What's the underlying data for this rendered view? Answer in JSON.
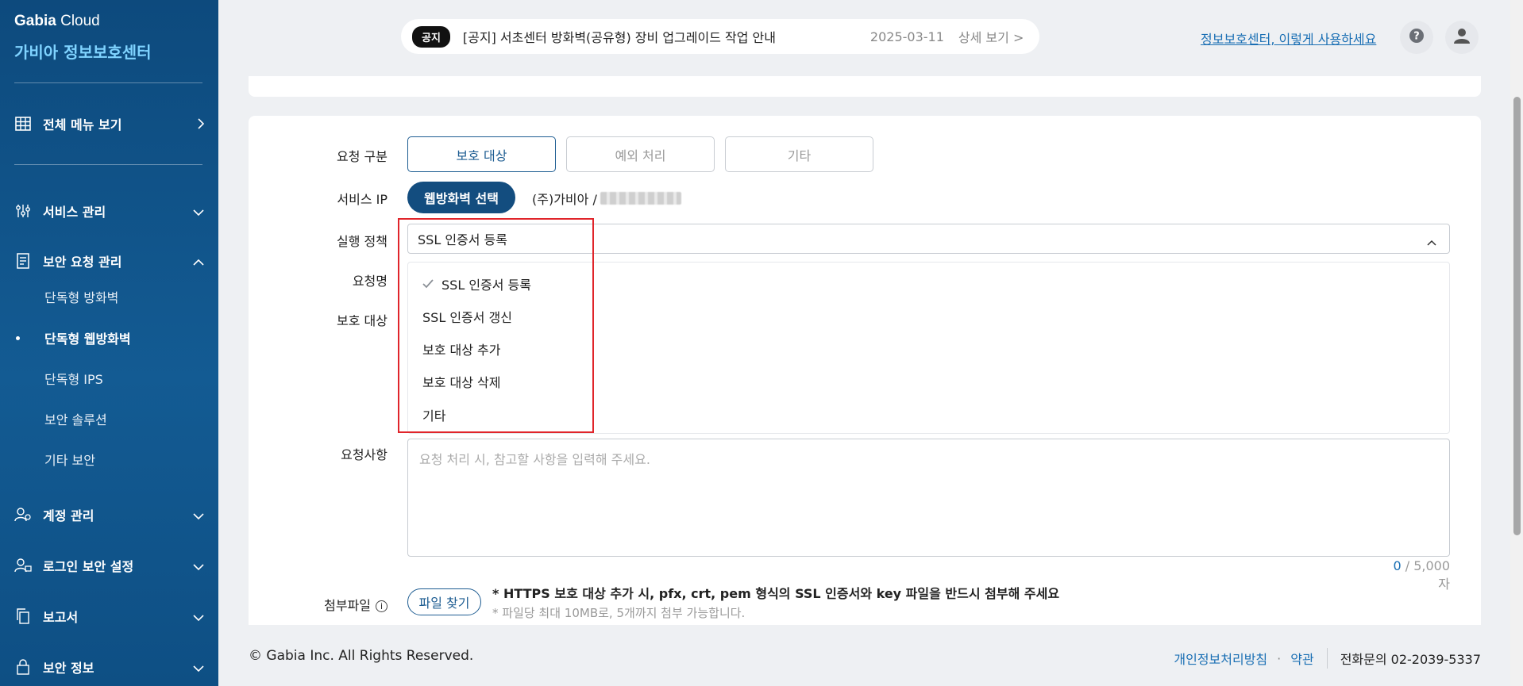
{
  "sidebar": {
    "brand_bold": "Gabia",
    "brand_rest": " Cloud",
    "brand_sub": "가비아 정보보호센터",
    "all_menu": "전체 메뉴 보기",
    "service_manage": "서비스 관리",
    "security_request": "보안 요청 관리",
    "sub_items": [
      "단독형 방화벽",
      "단독형 웹방화벽",
      "단독형 IPS",
      "보안 솔루션",
      "기타 보안"
    ],
    "account_manage": "계정 관리",
    "login_security": "로그인 보안 설정",
    "report": "보고서",
    "security_info": "보안 정보"
  },
  "notice": {
    "badge": "공지",
    "text": "[공지] 서초센터 방화벽(공유형) 장비 업그레이드 작업 안내",
    "date": "2025-03-11",
    "more": "상세 보기 >"
  },
  "header": {
    "help_link": "정보보호센터, 이렇게 사용하세요"
  },
  "form": {
    "request_type_label": "요청 구분",
    "request_types": [
      "보호 대상",
      "예외 처리",
      "기타"
    ],
    "service_ip_label": "서비스 IP",
    "waf_select": "웹방화벽 선택",
    "ip_prefix": "(주)가비아 /",
    "policy_label": "실행 정책",
    "policy_selected": "SSL 인증서 등록",
    "policy_options": [
      "SSL 인증서 등록",
      "SSL 인증서 갱신",
      "보호 대상 추가",
      "보호 대상 삭제",
      "기타"
    ],
    "request_name_label": "요청명",
    "protect_target_label": "보호 대상",
    "request_detail_label": "요청사항",
    "request_detail_placeholder": "요청 처리 시, 참고할 사항을 입력해 주세요.",
    "counter_num": "0",
    "counter_max": " / 5,000자",
    "attach_label": "첨부파일",
    "file_button": "파일 찾기",
    "file_note": "* HTTPS 보호 대상 추가 시, pfx, crt, pem 형식의 SSL 인증서와 key 파일을 반드시 첨부해 주세요",
    "file_note2": "* 파일당 최대 10MB로, 5개까지 첨부 가능합니다."
  },
  "footer": {
    "copyright": "© Gabia Inc. All Rights Reserved.",
    "privacy": "개인정보처리방침",
    "terms": "약관",
    "phone": "전화문의 02-2039-5337"
  }
}
